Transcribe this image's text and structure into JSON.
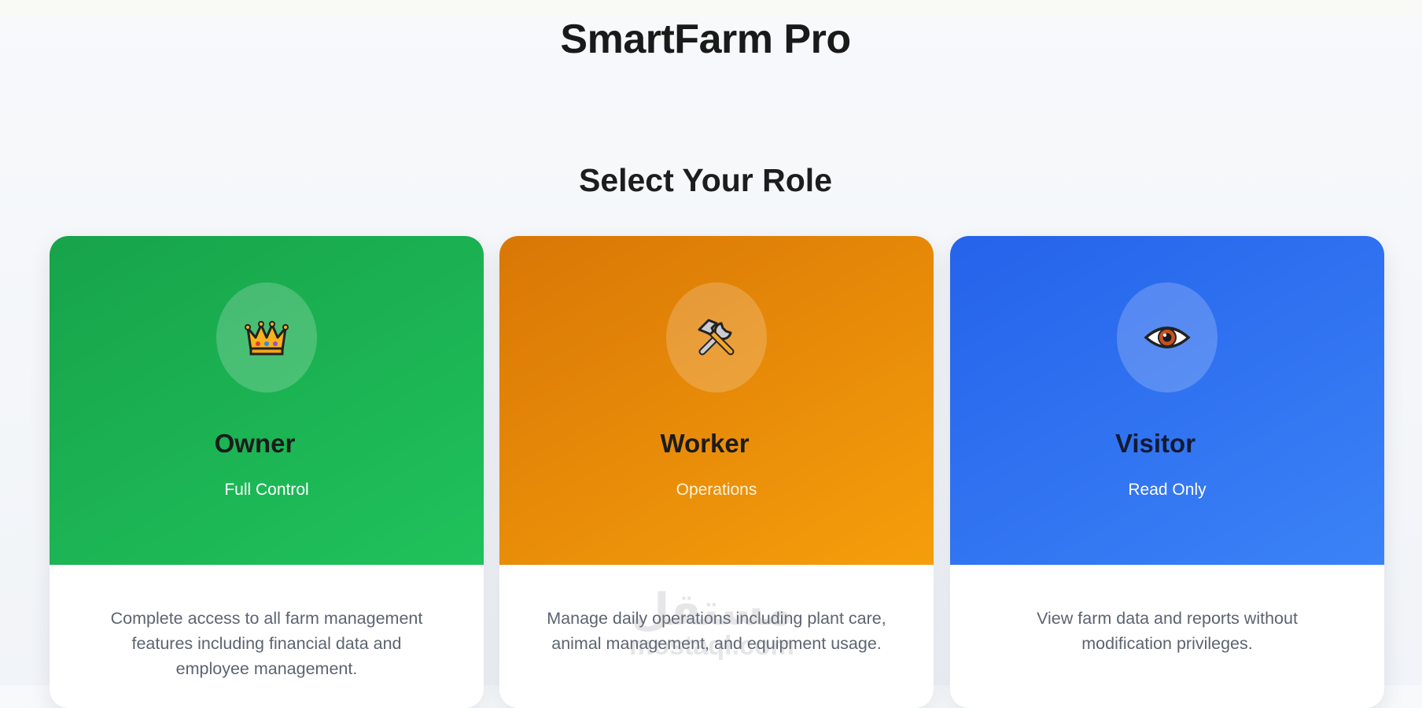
{
  "app": {
    "title": "SmartFarm Pro"
  },
  "section": {
    "title": "Select Your Role"
  },
  "roles": [
    {
      "name": "Owner",
      "tag": "Full Control",
      "icon": "crown-icon",
      "color": "#17a34a",
      "description": "Complete access to all farm management features including financial data and employee management."
    },
    {
      "name": "Worker",
      "tag": "Operations",
      "icon": "hammer-and-wrench-icon",
      "color": "#d97706",
      "description": "Manage daily operations including plant care, animal management, and equipment usage."
    },
    {
      "name": "Visitor",
      "tag": "Read Only",
      "icon": "eye-icon",
      "color": "#2563eb",
      "description": "View farm data and reports without modification privileges."
    }
  ],
  "watermark": {
    "arabic": "مستقل",
    "latin": "mostaql.com"
  }
}
